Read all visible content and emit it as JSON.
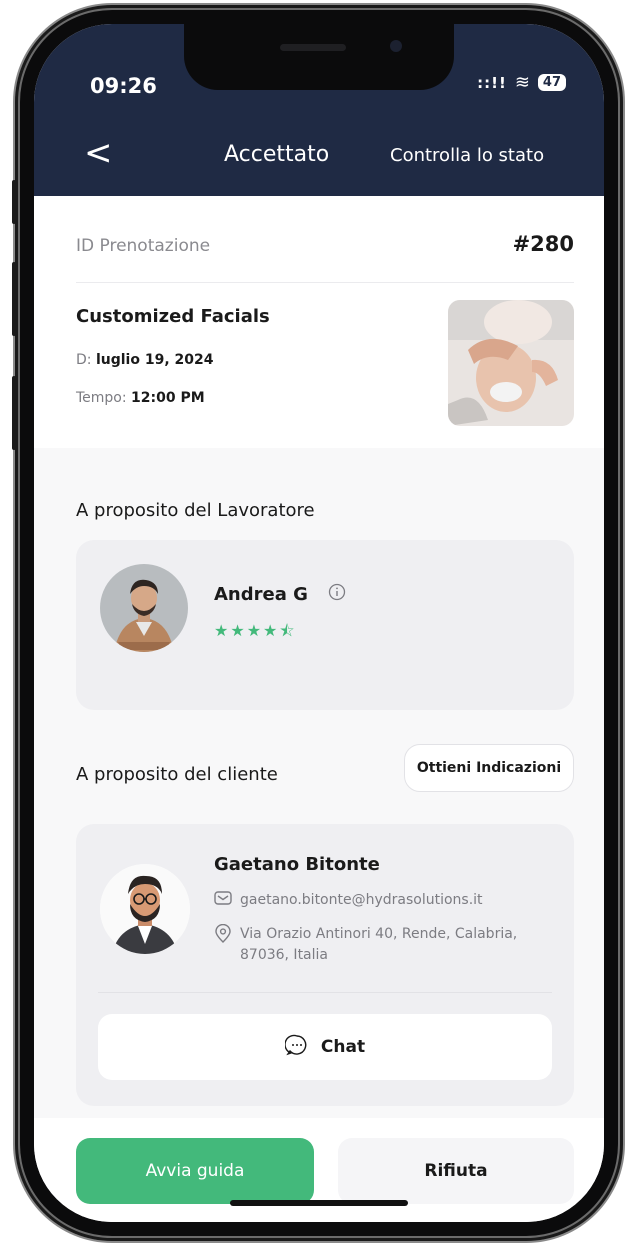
{
  "status_bar": {
    "time": "09:26",
    "battery": "47"
  },
  "nav": {
    "back_glyph": "<",
    "title": "Accettato",
    "action_label": "Controlla lo stato"
  },
  "booking": {
    "id_label": "ID Prenotazione",
    "id_value": "#280",
    "service_name": "Customized Facials",
    "date_prefix": "D:",
    "date_value": "luglio 19, 2024",
    "time_prefix": "Tempo:",
    "time_value": "12:00 PM"
  },
  "worker": {
    "section_title": "A proposito del Lavoratore",
    "name": "Andrea G",
    "rating": 4.5,
    "rating_max": 5
  },
  "client": {
    "section_title": "A proposito del cliente",
    "directions_label": "Ottieni Indicazioni",
    "name": "Gaetano Bitonte",
    "email": "gaetano.bitonte@hydrasolutions.it",
    "address": "Via Orazio Antinori 40, Rende, Calabria, 87036, Italia",
    "chat_label": "Chat"
  },
  "actions": {
    "start_label": "Avvia guida",
    "reject_label": "Rifiuta"
  },
  "colors": {
    "header": "#1f2a44",
    "accent_green": "#43b97b",
    "card_bg": "#efeff2"
  }
}
